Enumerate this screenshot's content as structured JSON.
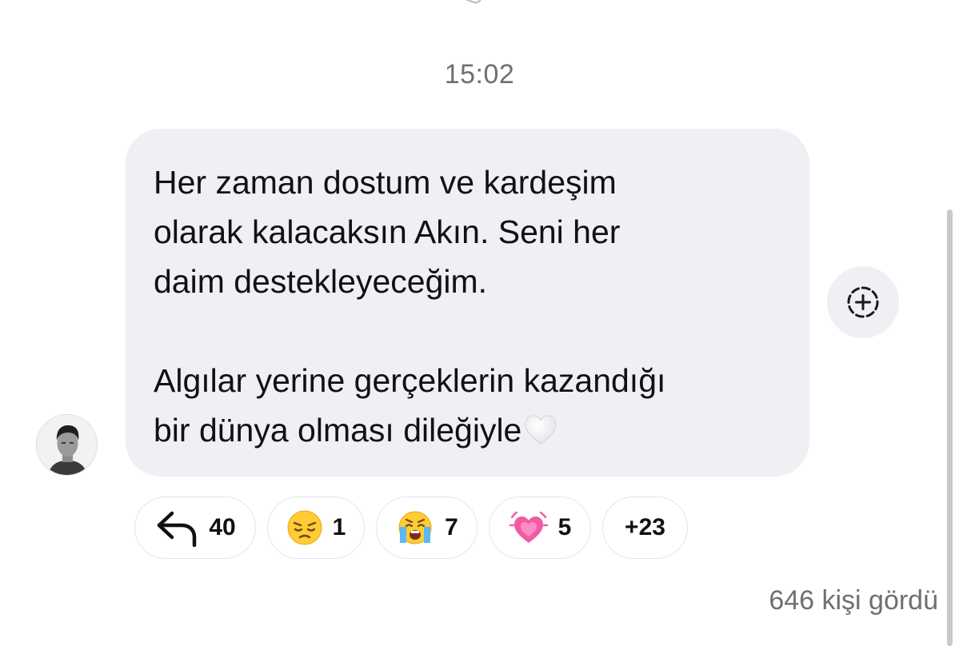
{
  "conversation": {
    "timestamp": "15:02"
  },
  "message": {
    "paragraph1_lines": [
      "Her zaman dostum ve kardeşim",
      "olarak kalacaksın Akın. Seni her",
      "daim destekleyeceğim."
    ],
    "paragraph2_lines": [
      "Algılar yerine gerçeklerin kazandığı",
      "bir dünya olması dileğiyle"
    ],
    "trailing_emoji": "white-heart"
  },
  "reactions": {
    "reply": {
      "icon": "reply-arrow-icon",
      "count": "40"
    },
    "items": [
      {
        "emoji": "pensive-face",
        "count": "1"
      },
      {
        "emoji": "loudly-crying-face",
        "count": "7"
      },
      {
        "emoji": "growing-heart",
        "count": "5"
      }
    ],
    "more": "+23"
  },
  "footer": {
    "views": "646 kişi gördü"
  },
  "colors": {
    "bubble": "#efeff4",
    "muted_text": "#6f6f74",
    "text": "#111114",
    "pill_border": "#e4e4e8"
  }
}
